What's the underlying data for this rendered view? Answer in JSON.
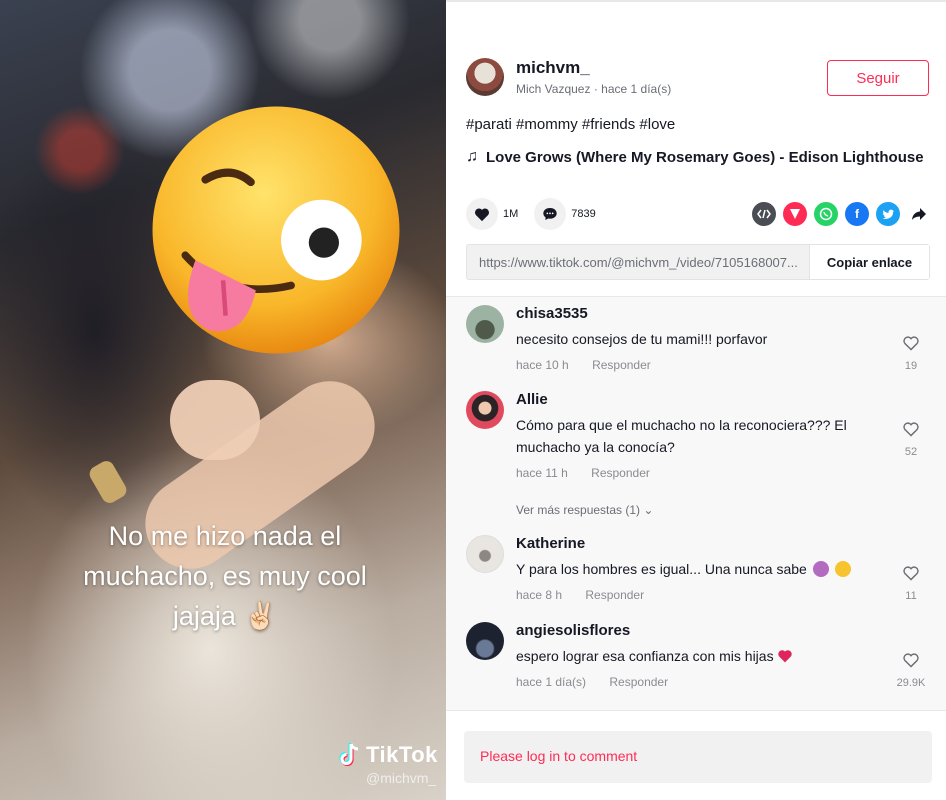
{
  "video": {
    "caption_line1": "No me hizo nada el",
    "caption_line2": "muchacho, es muy cool",
    "caption_line3": "jajaja",
    "caption_emoji": "✌🏻",
    "watermark_brand": "TikTok",
    "watermark_user": "@michvm_"
  },
  "author": {
    "username": "michvm_",
    "display_name": "Mich Vazquez",
    "time": "hace 1 día(s)",
    "follow_label": "Seguir"
  },
  "description": "#parati #mommy #friends #love",
  "music": "Love Grows (Where My Rosemary Goes) - Edison Lighthouse",
  "stats": {
    "likes": "1M",
    "comments": "7839"
  },
  "share_icons": [
    "embed-icon",
    "send-icon",
    "whatsapp-icon",
    "facebook-icon",
    "twitter-icon",
    "share-arrow-icon"
  ],
  "link": {
    "url": "https://www.tiktok.com/@michvm_/video/7105168007...",
    "copy_label": "Copiar enlace"
  },
  "comments": [
    {
      "user": "chisa3535",
      "text": "necesito consejos de tu mami!!! porfavor",
      "time": "hace 10 h",
      "reply": "Responder",
      "likes": "19"
    },
    {
      "user": "Allie",
      "text": "Cómo para que el muchacho no la reconociera??? El muchacho ya la conocía?",
      "time": "hace 11 h",
      "reply": "Responder",
      "likes": "52",
      "more_replies": "Ver más respuestas (1)"
    },
    {
      "user": "Katherine",
      "text": "Y para los hombres es igual... Una nunca sabe",
      "time": "hace 8 h",
      "reply": "Responder",
      "likes": "11"
    },
    {
      "user": "angiesolisflores",
      "text": "espero lograr esa confianza con mis hijas",
      "time": "hace 1 día(s)",
      "reply": "Responder",
      "likes": "29.9K"
    }
  ],
  "login_prompt": "Please log in to comment",
  "colors": {
    "accent": "#fe2c55",
    "muted": "#8a8b91"
  }
}
